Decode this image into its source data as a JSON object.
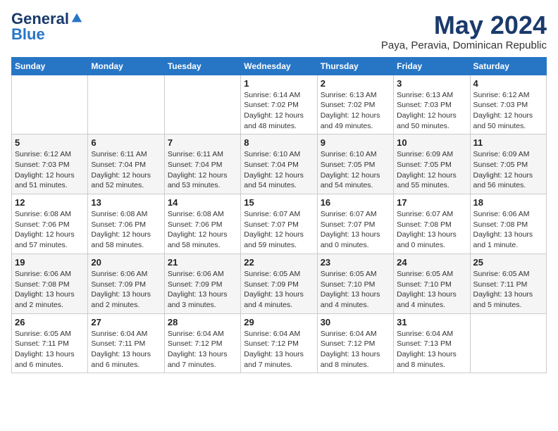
{
  "logo": {
    "general": "General",
    "blue": "Blue"
  },
  "header": {
    "month": "May 2024",
    "location": "Paya, Peravia, Dominican Republic"
  },
  "weekdays": [
    "Sunday",
    "Monday",
    "Tuesday",
    "Wednesday",
    "Thursday",
    "Friday",
    "Saturday"
  ],
  "weeks": [
    [
      {
        "day": "",
        "info": ""
      },
      {
        "day": "",
        "info": ""
      },
      {
        "day": "",
        "info": ""
      },
      {
        "day": "1",
        "info": "Sunrise: 6:14 AM\nSunset: 7:02 PM\nDaylight: 12 hours and 48 minutes."
      },
      {
        "day": "2",
        "info": "Sunrise: 6:13 AM\nSunset: 7:02 PM\nDaylight: 12 hours and 49 minutes."
      },
      {
        "day": "3",
        "info": "Sunrise: 6:13 AM\nSunset: 7:03 PM\nDaylight: 12 hours and 50 minutes."
      },
      {
        "day": "4",
        "info": "Sunrise: 6:12 AM\nSunset: 7:03 PM\nDaylight: 12 hours and 50 minutes."
      }
    ],
    [
      {
        "day": "5",
        "info": "Sunrise: 6:12 AM\nSunset: 7:03 PM\nDaylight: 12 hours and 51 minutes."
      },
      {
        "day": "6",
        "info": "Sunrise: 6:11 AM\nSunset: 7:04 PM\nDaylight: 12 hours and 52 minutes."
      },
      {
        "day": "7",
        "info": "Sunrise: 6:11 AM\nSunset: 7:04 PM\nDaylight: 12 hours and 53 minutes."
      },
      {
        "day": "8",
        "info": "Sunrise: 6:10 AM\nSunset: 7:04 PM\nDaylight: 12 hours and 54 minutes."
      },
      {
        "day": "9",
        "info": "Sunrise: 6:10 AM\nSunset: 7:05 PM\nDaylight: 12 hours and 54 minutes."
      },
      {
        "day": "10",
        "info": "Sunrise: 6:09 AM\nSunset: 7:05 PM\nDaylight: 12 hours and 55 minutes."
      },
      {
        "day": "11",
        "info": "Sunrise: 6:09 AM\nSunset: 7:05 PM\nDaylight: 12 hours and 56 minutes."
      }
    ],
    [
      {
        "day": "12",
        "info": "Sunrise: 6:08 AM\nSunset: 7:06 PM\nDaylight: 12 hours and 57 minutes."
      },
      {
        "day": "13",
        "info": "Sunrise: 6:08 AM\nSunset: 7:06 PM\nDaylight: 12 hours and 58 minutes."
      },
      {
        "day": "14",
        "info": "Sunrise: 6:08 AM\nSunset: 7:06 PM\nDaylight: 12 hours and 58 minutes."
      },
      {
        "day": "15",
        "info": "Sunrise: 6:07 AM\nSunset: 7:07 PM\nDaylight: 12 hours and 59 minutes."
      },
      {
        "day": "16",
        "info": "Sunrise: 6:07 AM\nSunset: 7:07 PM\nDaylight: 13 hours and 0 minutes."
      },
      {
        "day": "17",
        "info": "Sunrise: 6:07 AM\nSunset: 7:08 PM\nDaylight: 13 hours and 0 minutes."
      },
      {
        "day": "18",
        "info": "Sunrise: 6:06 AM\nSunset: 7:08 PM\nDaylight: 13 hours and 1 minute."
      }
    ],
    [
      {
        "day": "19",
        "info": "Sunrise: 6:06 AM\nSunset: 7:08 PM\nDaylight: 13 hours and 2 minutes."
      },
      {
        "day": "20",
        "info": "Sunrise: 6:06 AM\nSunset: 7:09 PM\nDaylight: 13 hours and 2 minutes."
      },
      {
        "day": "21",
        "info": "Sunrise: 6:06 AM\nSunset: 7:09 PM\nDaylight: 13 hours and 3 minutes."
      },
      {
        "day": "22",
        "info": "Sunrise: 6:05 AM\nSunset: 7:09 PM\nDaylight: 13 hours and 4 minutes."
      },
      {
        "day": "23",
        "info": "Sunrise: 6:05 AM\nSunset: 7:10 PM\nDaylight: 13 hours and 4 minutes."
      },
      {
        "day": "24",
        "info": "Sunrise: 6:05 AM\nSunset: 7:10 PM\nDaylight: 13 hours and 4 minutes."
      },
      {
        "day": "25",
        "info": "Sunrise: 6:05 AM\nSunset: 7:11 PM\nDaylight: 13 hours and 5 minutes."
      }
    ],
    [
      {
        "day": "26",
        "info": "Sunrise: 6:05 AM\nSunset: 7:11 PM\nDaylight: 13 hours and 6 minutes."
      },
      {
        "day": "27",
        "info": "Sunrise: 6:04 AM\nSunset: 7:11 PM\nDaylight: 13 hours and 6 minutes."
      },
      {
        "day": "28",
        "info": "Sunrise: 6:04 AM\nSunset: 7:12 PM\nDaylight: 13 hours and 7 minutes."
      },
      {
        "day": "29",
        "info": "Sunrise: 6:04 AM\nSunset: 7:12 PM\nDaylight: 13 hours and 7 minutes."
      },
      {
        "day": "30",
        "info": "Sunrise: 6:04 AM\nSunset: 7:12 PM\nDaylight: 13 hours and 8 minutes."
      },
      {
        "day": "31",
        "info": "Sunrise: 6:04 AM\nSunset: 7:13 PM\nDaylight: 13 hours and 8 minutes."
      },
      {
        "day": "",
        "info": ""
      }
    ]
  ]
}
